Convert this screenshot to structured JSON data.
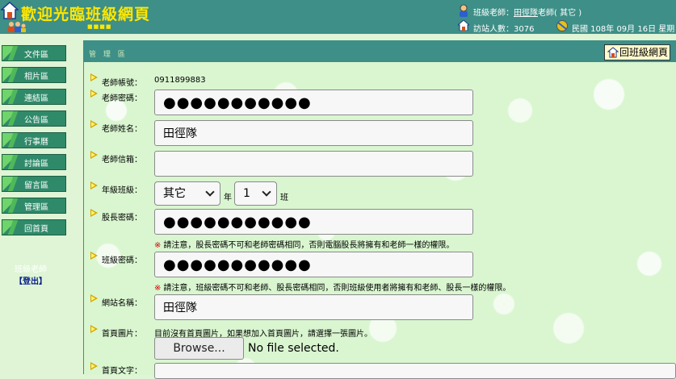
{
  "header": {
    "title": "歡迎光臨班級網頁",
    "dots": "■■■■",
    "teacher_label": "班級老師：",
    "teacher_name": "田徑隊",
    "teacher_suffix": "老師( 其它 )",
    "visitors_label": "訪站人數：",
    "visitors_count": "3076",
    "date": "民國 108年 09月 16日 星期"
  },
  "sidebar": {
    "items": [
      {
        "label": "文件區"
      },
      {
        "label": "相片區"
      },
      {
        "label": "連結區"
      },
      {
        "label": "公告區"
      },
      {
        "label": "行事曆"
      },
      {
        "label": "討論區"
      },
      {
        "label": "留言區"
      },
      {
        "label": "管理區"
      },
      {
        "label": "回首頁"
      }
    ],
    "teacher_text": "班級老師",
    "logout": "【登出】"
  },
  "main": {
    "title": "管 理 區",
    "back_button": "回班級網頁"
  },
  "form": {
    "account_label": "老師帳號：",
    "account_value": "0911899883",
    "password_label": "老師密碼：",
    "password_value": "●●●●●●●●●●●",
    "name_label": "老師姓名：",
    "name_value": "田徑隊",
    "email_label": "老師信箱：",
    "email_value": "",
    "grade_label": "年級班級：",
    "grade_value": "其它",
    "grade_unit": "年",
    "class_value": "1",
    "class_unit": "班",
    "leader_pw_label": "股長密碼：",
    "leader_pw_value": "●●●●●●●●●●●",
    "leader_note_star": "※",
    "leader_note": "請注意，股長密碼不可和老師密碼相同，否則電腦股長將擁有和老師一樣的權限。",
    "class_pw_label": "班級密碼：",
    "class_pw_value": "●●●●●●●●●●●",
    "class_note_star": "※",
    "class_note": "請注意，班級密碼不可和老師、股長密碼相同，否則班級使用者將擁有和老師、股長一樣的權限。",
    "site_name_label": "網站名稱：",
    "site_name_value": "田徑隊",
    "home_image_label": "首頁圖片：",
    "home_image_note": "目前沒有首頁圖片，如果想加入首頁圖片，請選擇一張圖片。",
    "browse_button": "Browse...",
    "no_file": "No file selected.",
    "home_text_label": "首頁文字："
  }
}
